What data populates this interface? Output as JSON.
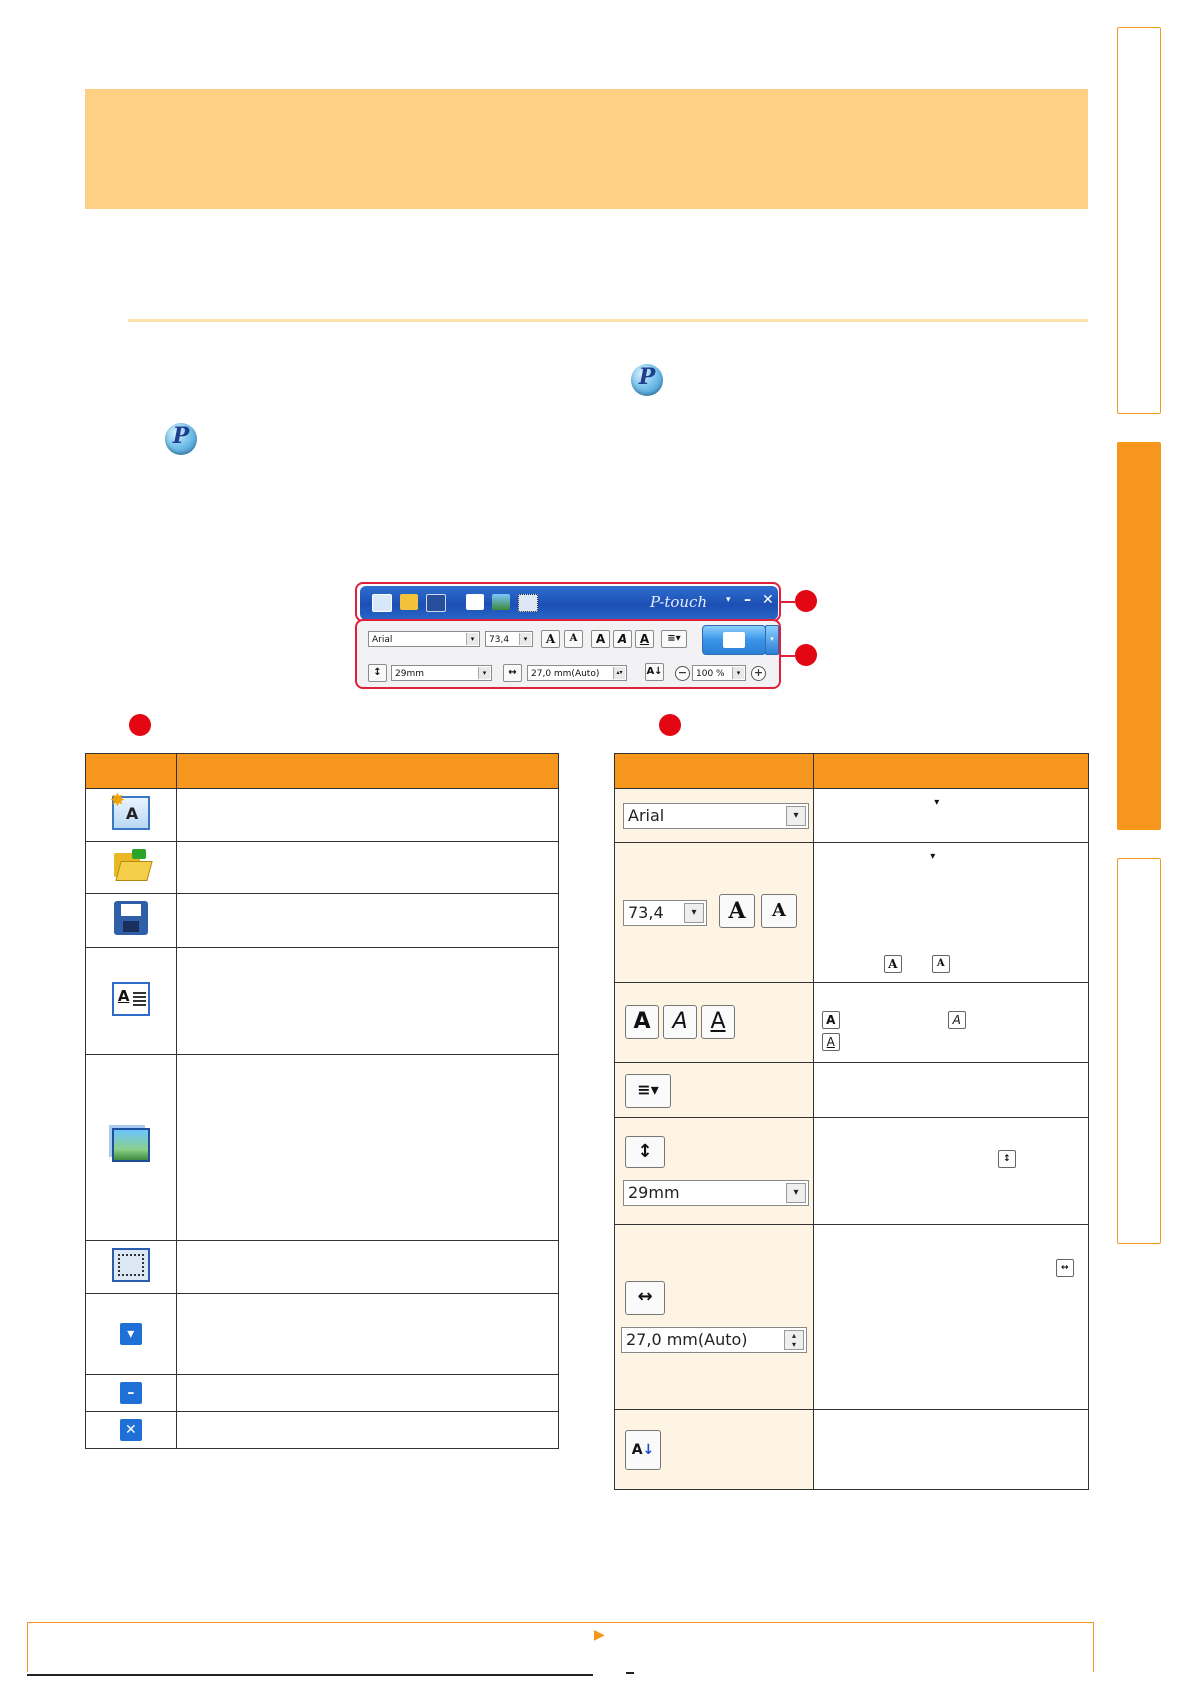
{
  "toolbar_graphic": {
    "brand": "P-touch",
    "font_field": "Arial",
    "size_field": "73,4",
    "height_field": "29mm",
    "width_field": "27,0 mm(Auto)",
    "zoom_field": "100 %"
  },
  "right_table_controls": {
    "font_combo": "Arial",
    "size_combo": "73,4",
    "height_combo": "29mm",
    "width_spinner": "27,0 mm(Auto)"
  },
  "colors": {
    "accent_orange": "#f7961d",
    "header_band": "#fdd084",
    "callout_red": "#e30613",
    "toolbar_blue": "#1c4fb4"
  },
  "icons": [
    "p-touch-icon",
    "new-layout-icon",
    "open-icon",
    "save-icon",
    "insert-text-icon",
    "insert-image-icon",
    "insert-frame-icon",
    "menu-dropdown-icon",
    "minimize-icon",
    "close-icon",
    "text-style-icon",
    "align-icon",
    "height-icon",
    "width-icon",
    "vertical-text-icon"
  ]
}
